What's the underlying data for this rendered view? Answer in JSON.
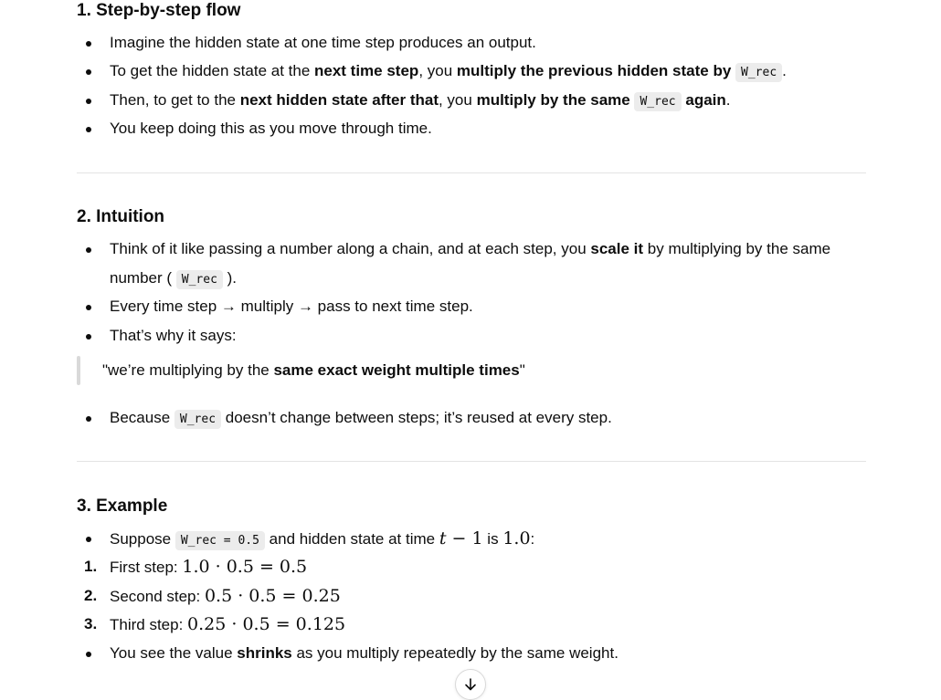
{
  "sections": [
    {
      "heading": "1. Step-by-step flow",
      "items": [
        "Imagine the hidden state at one time step produces an output.",
        {
          "pre": "To get the hidden state at the ",
          "b1": "next time step",
          "mid": ", you ",
          "b2": "multiply the previous hidden state by",
          "code": "W_rec",
          "post": "."
        },
        {
          "pre": "Then, to get to the ",
          "b1": "next hidden state after that",
          "mid": ", you ",
          "b2": "multiply by the same",
          "code": "W_rec",
          "b3": "again",
          "post": "."
        },
        "You keep doing this as you move through time."
      ]
    },
    {
      "heading": "2. Intuition",
      "items": [
        {
          "pre": "Think of it like passing a number along a chain, and at each step, you ",
          "b1": "scale it",
          "post": " by multiplying by the same",
          "line2_pre": "number (",
          "code": "W_rec",
          "line2_post": ")."
        },
        "Every time step → multiply → pass to next time step.",
        "That’s why it says:"
      ],
      "quote": {
        "pre": "\"we’re multiplying by the ",
        "bold": "same exact weight multiple times",
        "post": "\""
      },
      "after_quote": {
        "pre": "Because ",
        "code": "W_rec",
        "post": " doesn’t change between steps; it’s reused at every step."
      }
    },
    {
      "heading": "3. Example",
      "suppose": {
        "pre": "Suppose ",
        "code": "W_rec = 0.5",
        "mid": " and hidden state at time ",
        "math_t": "t",
        "math_rest": " − 1",
        "is": " is ",
        "math_val": "1.0",
        "post": ":"
      },
      "steps": [
        {
          "num": "1.",
          "label": "First step: ",
          "math": "1.0 · 0.5 = 0.5"
        },
        {
          "num": "2.",
          "label": "Second step: ",
          "math": "0.5 · 0.5 = 0.25"
        },
        {
          "num": "3.",
          "label": "Third step: ",
          "math": "0.25 · 0.5 = 0.125"
        }
      ],
      "conclusion": {
        "pre": "You see the value ",
        "bold": "shrinks",
        "post": " as you multiply repeatedly by the same weight."
      }
    }
  ],
  "scroll_button": {
    "icon": "arrow-down-icon"
  }
}
